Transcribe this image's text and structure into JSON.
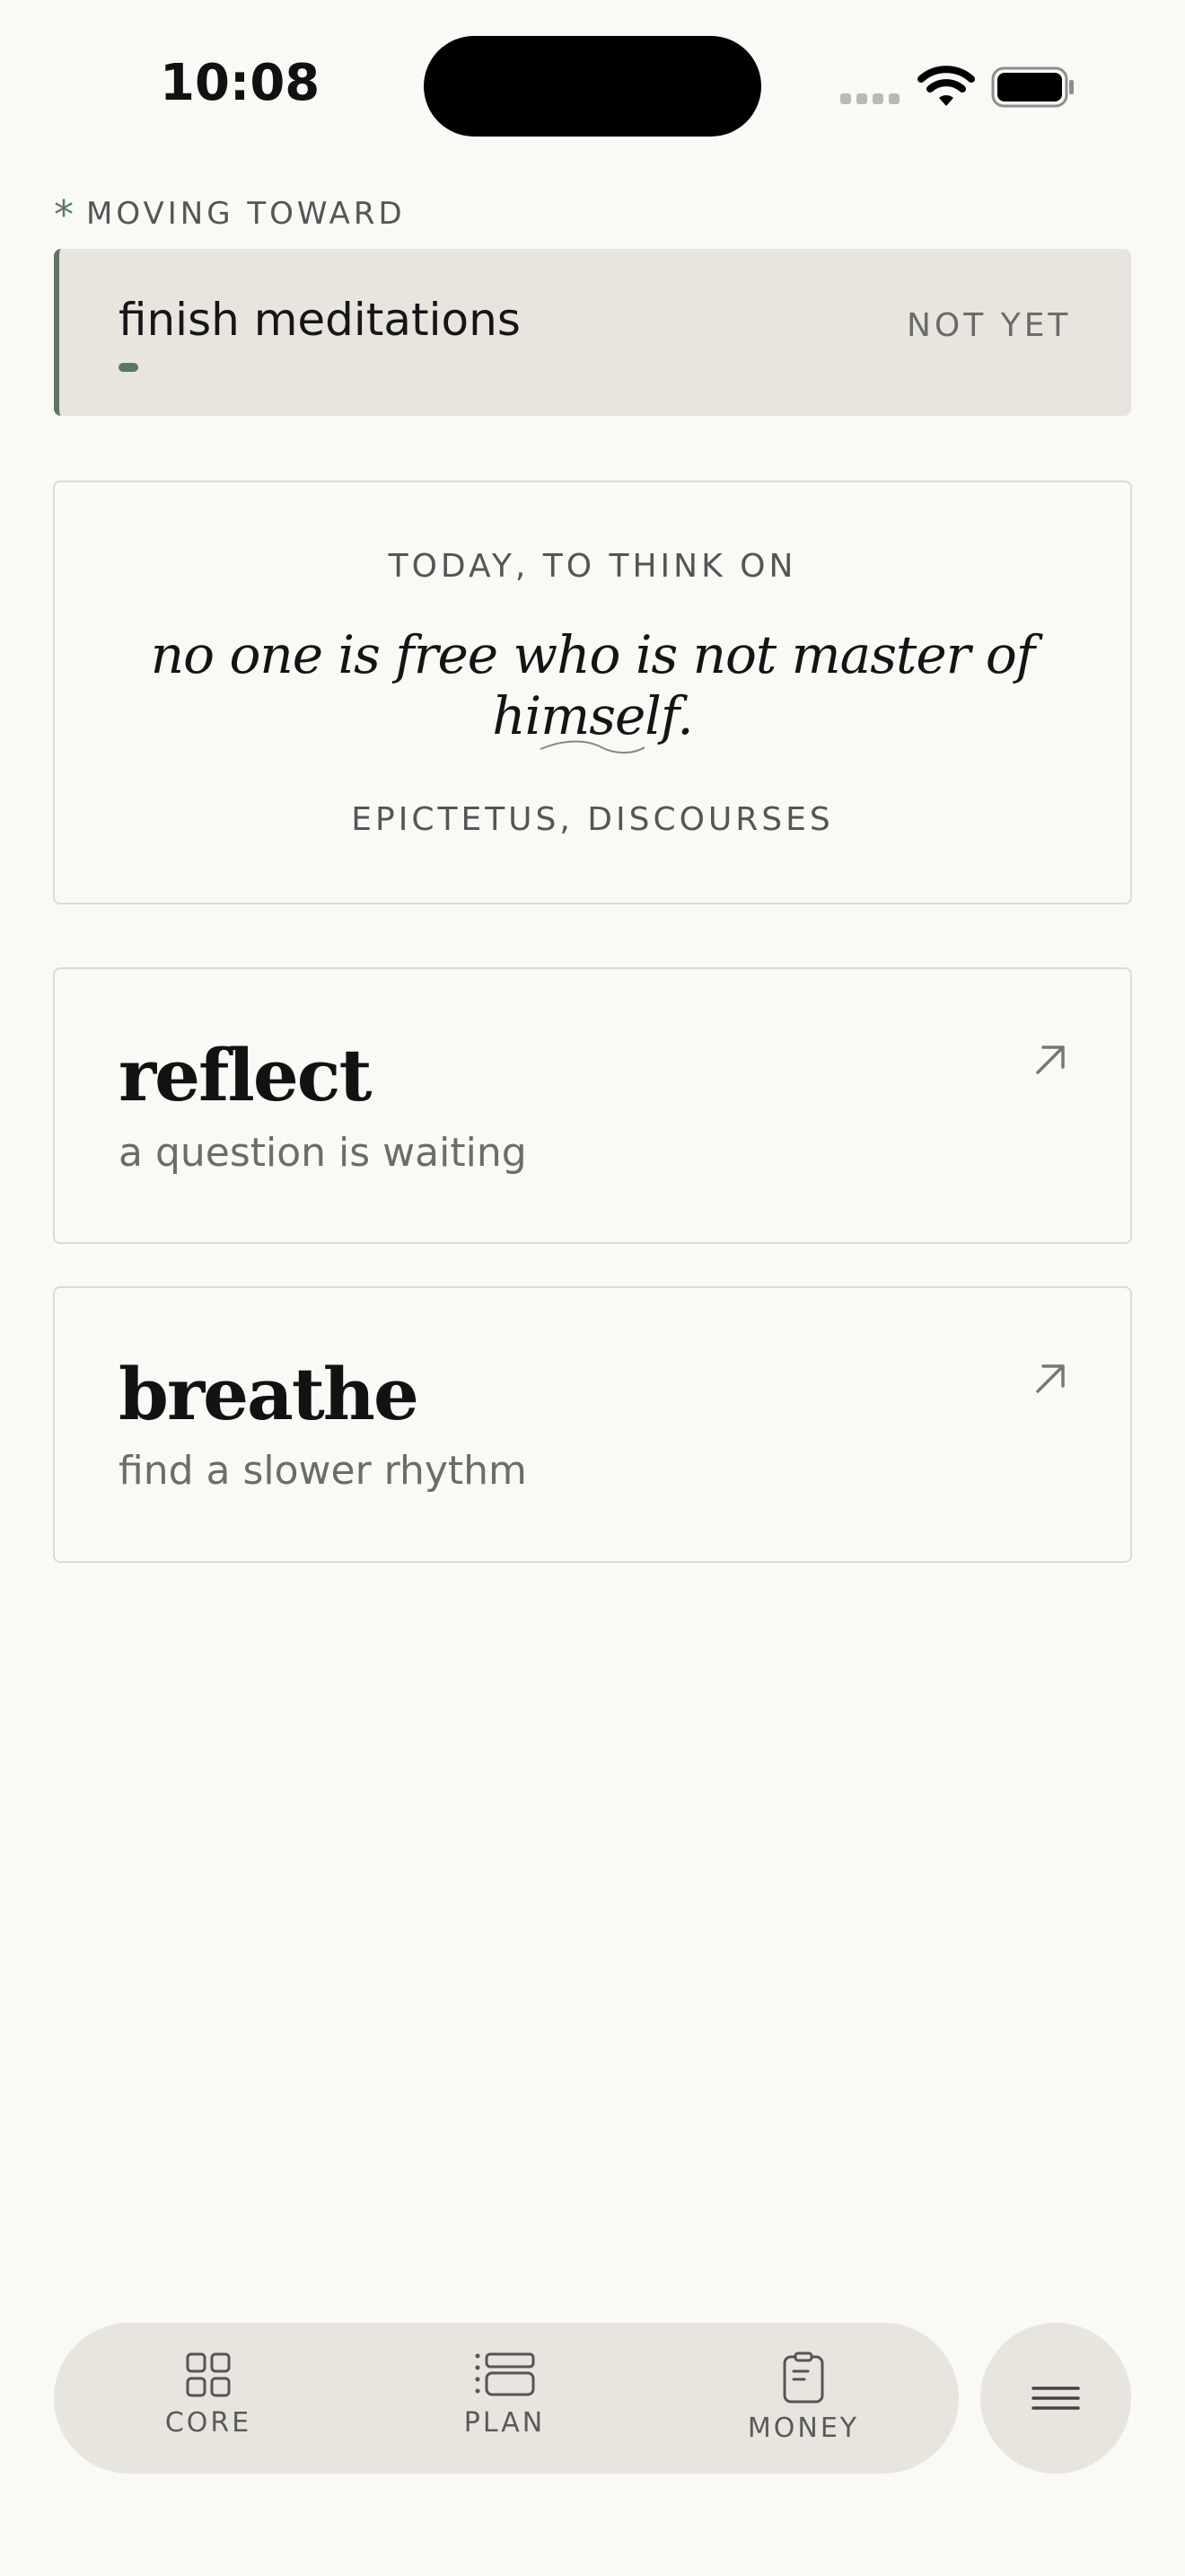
{
  "status_bar": {
    "time": "10:08",
    "icons": [
      "cellular-signal-icon",
      "wifi-icon",
      "battery-icon"
    ]
  },
  "moving_toward": {
    "label": "MOVING TOWARD",
    "asterisk": "*",
    "goal_title": "finish meditations",
    "goal_status": "NOT YET",
    "accent_color": "#5e7660"
  },
  "quote": {
    "kicker": "TODAY, TO THINK ON",
    "text": "no one is free who is not master of himself.",
    "source": "EPICTETUS, DISCOURSES"
  },
  "actions": [
    {
      "title": "reflect",
      "subtitle": "a question is waiting",
      "icon": "arrow-up-right-icon"
    },
    {
      "title": "breathe",
      "subtitle": "find a slower rhythm",
      "icon": "arrow-up-right-icon"
    }
  ],
  "nav": {
    "items": [
      {
        "label": "CORE",
        "icon": "grid-icon"
      },
      {
        "label": "PLAN",
        "icon": "list-icon"
      },
      {
        "label": "MONEY",
        "icon": "clipboard-icon"
      }
    ],
    "menu_icon": "hamburger-menu-icon"
  },
  "colors": {
    "background": "#f9f9f6",
    "card_fill": "#e8e5de",
    "accent": "#5e7660"
  }
}
